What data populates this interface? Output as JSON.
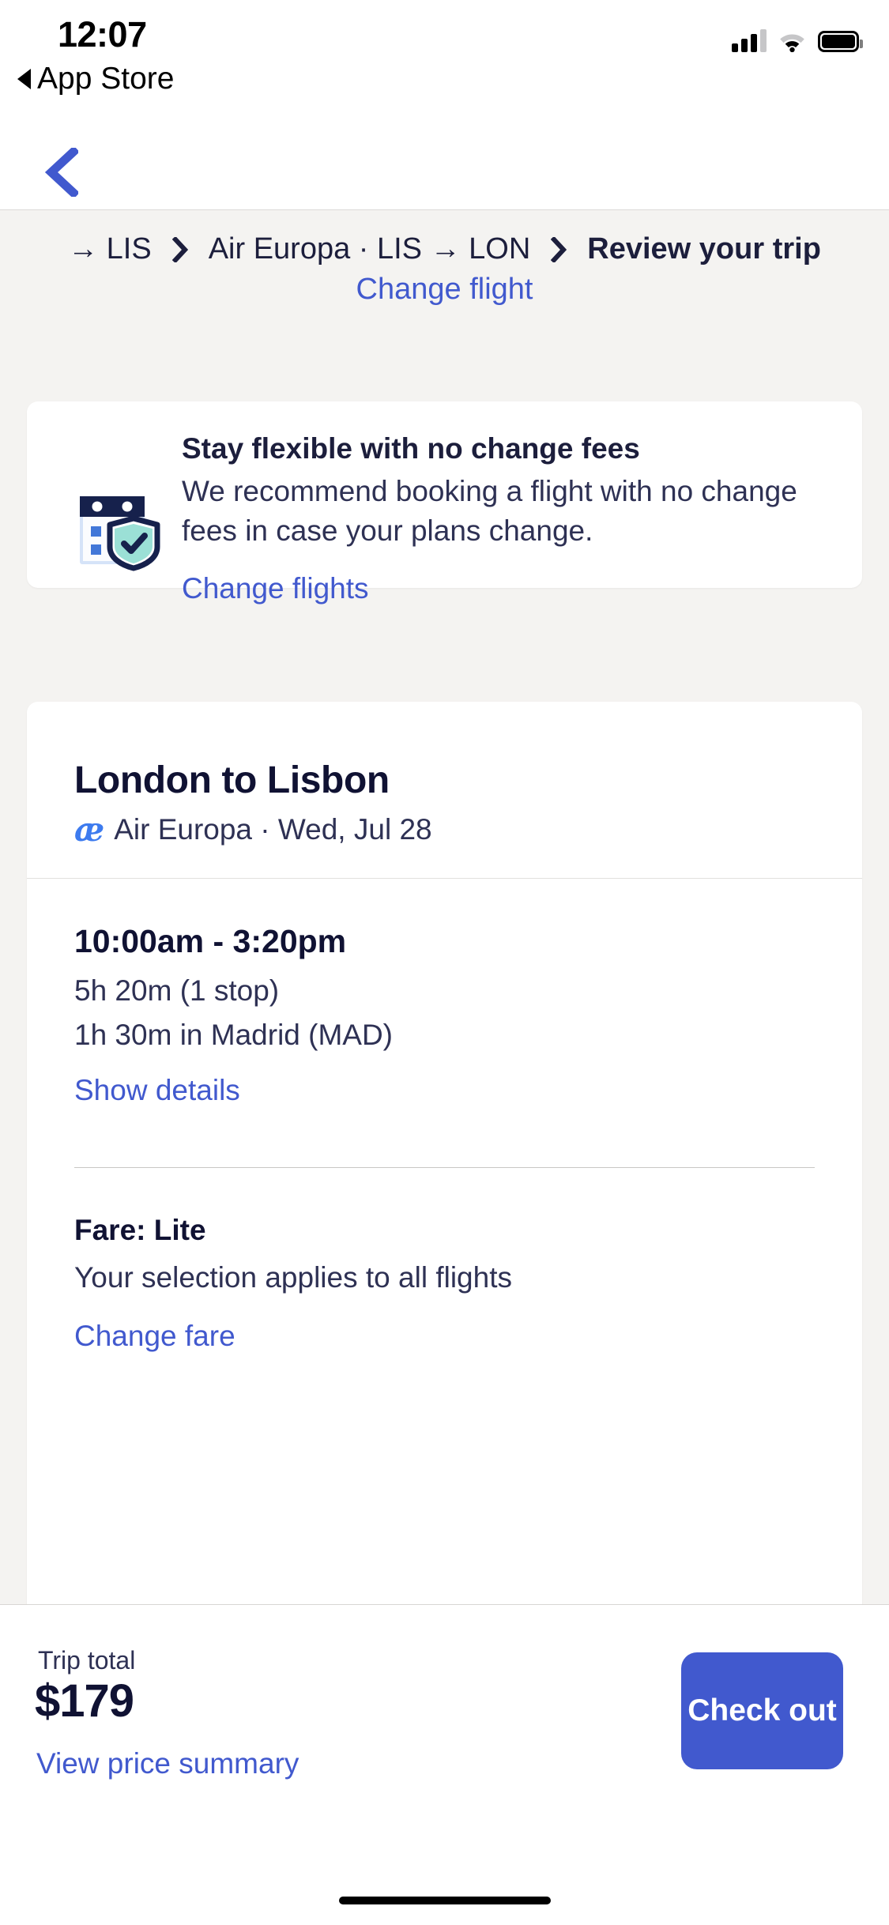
{
  "status_bar": {
    "time": "12:07",
    "return_app": "App Store",
    "icons": {
      "signal": "cellular-signal-icon",
      "wifi": "wifi-icon",
      "battery": "battery-icon"
    }
  },
  "nav": {
    "back_icon": "chevron-left-icon"
  },
  "breadcrumb": {
    "segments": [
      {
        "label": "→ LIS",
        "current": false
      },
      {
        "label": "Air Europa · LIS → LON",
        "current": false
      },
      {
        "label": "Review your trip",
        "current": true
      }
    ],
    "separator_icon": "chevron-right-icon",
    "change_link": "Change flight"
  },
  "flex_card": {
    "icon": "calendar-shield-icon",
    "title": "Stay flexible with no change fees",
    "description": "We recommend booking a flight with no change fees in case your plans change.",
    "link": "Change flights"
  },
  "flight_card": {
    "route": "London to Lisbon",
    "airline_logo": "air-europa-logo",
    "airline_and_date": "Air Europa · Wed, Jul 28",
    "times": "10:00am - 3:20pm",
    "duration": "5h 20m (1 stop)",
    "layover": "1h 30m in Madrid (MAD)",
    "details_link": "Show details",
    "fare_title": "Fare: Lite",
    "fare_note": "Your selection applies to all flights",
    "fare_link": "Change fare"
  },
  "bottom_bar": {
    "total_label": "Trip total",
    "total_price": "$179",
    "price_summary_link": "View price summary",
    "checkout_label": "Check out"
  },
  "colors": {
    "accent_blue": "#4159CE",
    "text_navy": "#101233",
    "page_background": "#F4F3F1",
    "card_white": "#FFFFFF",
    "icon_navy": "#16214C",
    "icon_mint": "#9BE0D6",
    "icon_light_blue": "#D5E3F8",
    "icon_blue": "#4277D8"
  }
}
